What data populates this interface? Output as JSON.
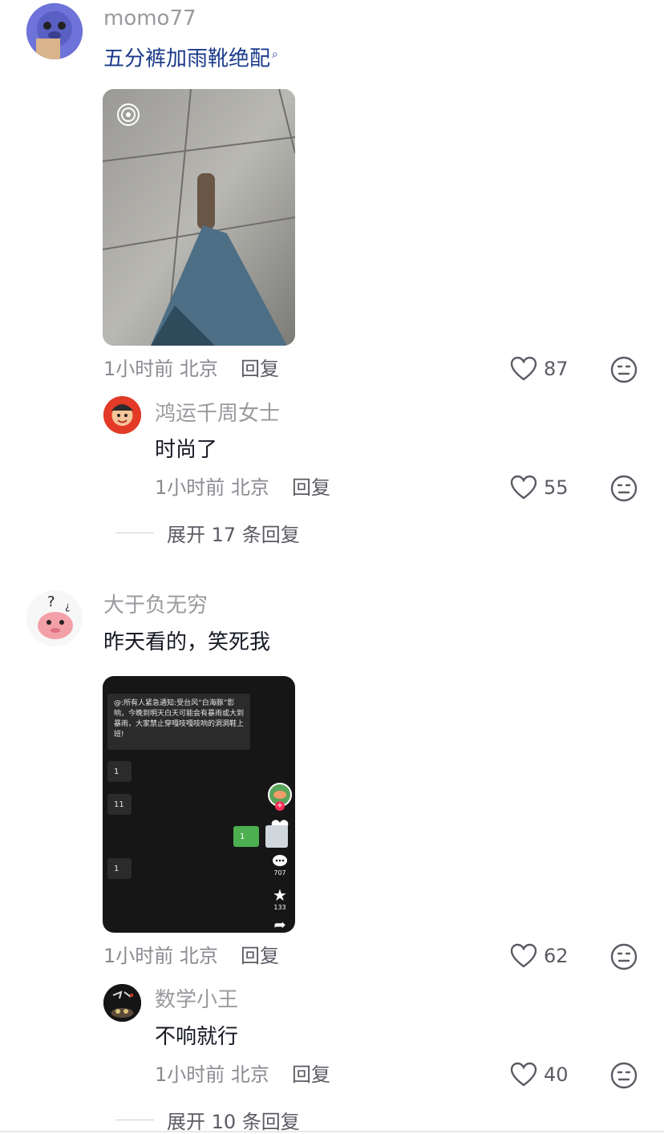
{
  "comments": [
    {
      "username": "momo77",
      "text": "五分裤加雨靴绝配",
      "search_hint": "search-icon",
      "time": "1小时前",
      "location": "北京",
      "reply_label": "回复",
      "likes": "87",
      "reply": {
        "username": "鸿运千周女士",
        "text": "时尚了",
        "time": "1小时前",
        "location": "北京",
        "reply_label": "回复",
        "likes": "55"
      },
      "expand_label": "展开 17 条回复"
    },
    {
      "username": "大于负无穷",
      "text": "昨天看的，笑死我",
      "time": "1小时前",
      "location": "北京",
      "reply_label": "回复",
      "likes": "62",
      "screenshot": {
        "notice": "@:所有人紧急通知:受台风“白海豚”影响，今晚到明天白天可能会有暴雨或大到暴雨，大家禁止穿嘎吱嘎吱响的洞洞鞋上班!",
        "bubbles": [
          "1",
          "11",
          "1",
          "1"
        ],
        "comment_count": "707",
        "fav_count": "133"
      },
      "reply": {
        "username": "数学小王",
        "text": "不响就行",
        "time": "1小时前",
        "location": "北京",
        "reply_label": "回复",
        "likes": "40"
      },
      "expand_label": "展开 10 条回复"
    }
  ],
  "colors": {
    "username": "#9a9a9f",
    "text": "#161823",
    "link": "#1a3a8a",
    "meta": "#8a8b91"
  }
}
